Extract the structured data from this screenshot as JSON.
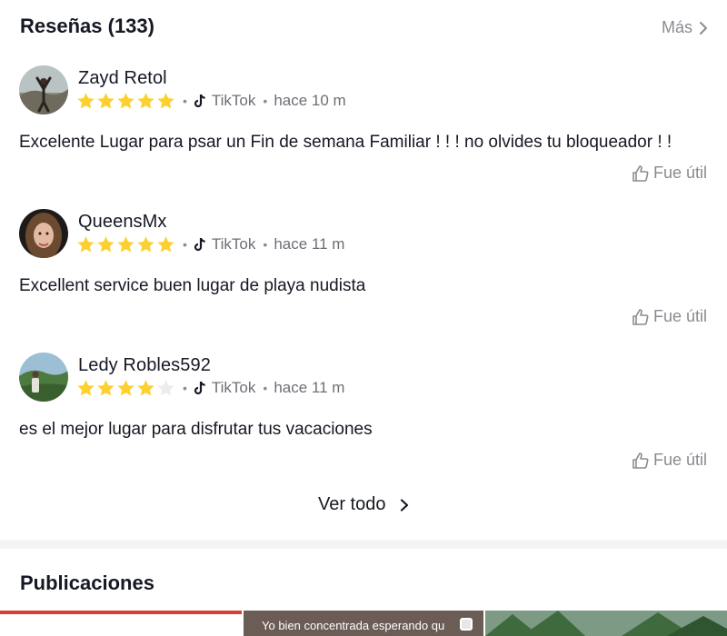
{
  "reviews": {
    "title": "Reseñas (133)",
    "more_label": "Más",
    "items": [
      {
        "username": "Zayd Retol",
        "rating": 5,
        "source": "TikTok",
        "time": "hace 10 m",
        "text": "Excelente Lugar para psar un Fin de semana Familiar ! ! ! no olvides tu bloqueador ! !",
        "helpful_label": "Fue útil"
      },
      {
        "username": "QueensMx",
        "rating": 5,
        "source": "TikTok",
        "time": "hace 11 m",
        "text": "Excellent service buen lugar de playa nudista",
        "helpful_label": "Fue útil"
      },
      {
        "username": "Ledy Robles592",
        "rating": 4,
        "source": "TikTok",
        "time": "hace 11 m",
        "text": "es el mejor lugar para disfrutar tus vacaciones",
        "helpful_label": "Fue útil"
      }
    ],
    "see_all_label": "Ver todo"
  },
  "posts": {
    "title": "Publicaciones",
    "thumbnails": [
      {
        "caption": ""
      },
      {
        "caption": "Yo bien concentrada esperando qu"
      },
      {
        "caption": ""
      }
    ]
  },
  "colors": {
    "star_filled": "#fcd02e",
    "star_empty": "#ececec",
    "text_primary": "#161823",
    "text_secondary": "#8a8b91"
  }
}
